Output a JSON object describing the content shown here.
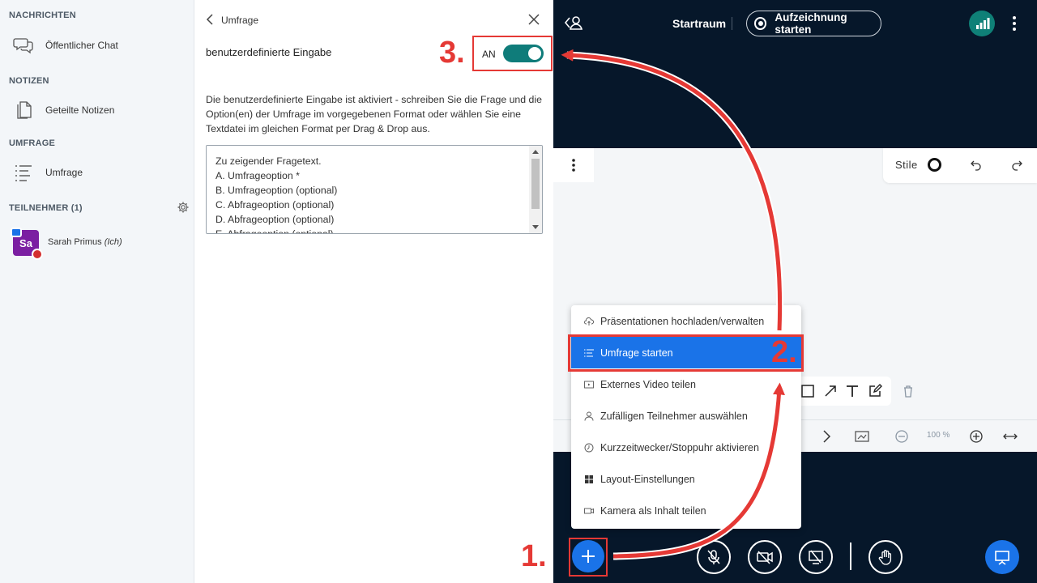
{
  "sidebar": {
    "messages_title": "NACHRICHTEN",
    "public_chat": "Öffentlicher Chat",
    "notes_title": "NOTIZEN",
    "shared_notes": "Geteilte Notizen",
    "poll_title": "UMFRAGE",
    "poll_item": "Umfrage",
    "participants_title": "TEILNEHMER (1)",
    "participant": {
      "initials": "Sa",
      "name": "Sarah Primus",
      "you": "(Ich)",
      "avatar_color": "#7b1fa2"
    }
  },
  "poll_panel": {
    "title": "Umfrage",
    "custom_input_label": "benutzerdefinierte Eingabe",
    "toggle_state": "AN",
    "description": "Die benutzerdefinierte Eingabe ist aktiviert - schreiben Sie die Frage und die Option(en) der Umfrage im vorgegebenen Format oder wählen Sie eine Textdatei im gleichen Format per Drag & Drop aus.",
    "textarea_lines": [
      "Zu zeigender Fragetext.",
      "A. Umfrageoption *",
      "B. Umfrageoption (optional)",
      "C. Abfrageoption (optional)",
      "D. Abfrageoption (optional)",
      "E. Abfrageoption (optional)"
    ]
  },
  "header": {
    "room": "Startraum",
    "record_button": "Aufzeichnung starten"
  },
  "whiteboard": {
    "styles_label": "Stile",
    "zoom": "100 %"
  },
  "actions_menu": [
    {
      "label": "Präsentationen hochladen/verwalten",
      "icon": "cloud-upload-icon"
    },
    {
      "label": "Umfrage starten",
      "icon": "poll-list-icon",
      "active": true
    },
    {
      "label": "Externes Video teilen",
      "icon": "video-icon"
    },
    {
      "label": "Zufälligen Teilnehmer auswählen",
      "icon": "user-icon"
    },
    {
      "label": "Kurzzeitwecker/Stoppuhr aktivieren",
      "icon": "timer-icon"
    },
    {
      "label": "Layout-Einstellungen",
      "icon": "layout-icon"
    },
    {
      "label": "Kamera als Inhalt teilen",
      "icon": "camera-icon"
    }
  ],
  "annotations": {
    "step1": "1.",
    "step2": "2.",
    "step3": "3."
  },
  "colors": {
    "accent": "#1a73e8",
    "toggle": "#0f7c7a",
    "annotation": "#e53935",
    "main_bg": "#06172a"
  }
}
